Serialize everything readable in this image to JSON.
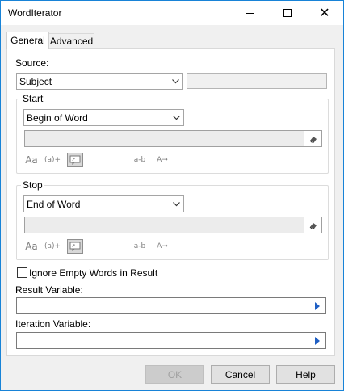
{
  "window": {
    "title": "WordIterator"
  },
  "tabs": [
    {
      "label": "General",
      "selected": true
    },
    {
      "label": "Advanced",
      "selected": false
    }
  ],
  "source": {
    "label": "Source:",
    "selected": "Subject",
    "extra_value": ""
  },
  "start": {
    "legend": "Start",
    "selected": "Begin of Word",
    "expression": "",
    "tools": [
      "Aa",
      "(a)+",
      "regex",
      "a-b",
      "A-replace"
    ]
  },
  "stop": {
    "legend": "Stop",
    "selected": "End of Word",
    "expression": "",
    "tools": [
      "Aa",
      "(a)+",
      "regex",
      "a-b",
      "A-replace"
    ]
  },
  "ignore_empty": {
    "label": "Ignore Empty Words in Result",
    "checked": false
  },
  "result_variable": {
    "label": "Result Variable:",
    "value": ""
  },
  "iteration_variable": {
    "label": "Iteration Variable:",
    "value": ""
  },
  "buttons": {
    "ok": "OK",
    "cancel": "Cancel",
    "help": "Help"
  },
  "tool_text": {
    "aa": "Aa",
    "group": "(a)+",
    "char": "a-b",
    "replace": "A→"
  }
}
